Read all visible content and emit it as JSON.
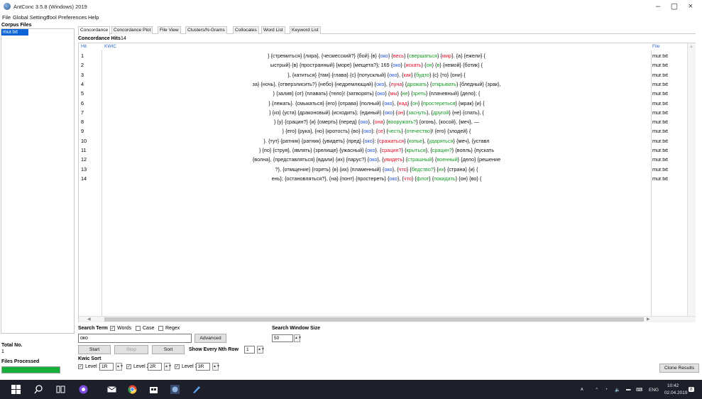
{
  "window": {
    "title": "AntConc 3.5.8 (Windows) 2019",
    "minimize": "–",
    "maximize": "▢",
    "close": "×"
  },
  "menu": [
    "File",
    "Global Settings",
    "Tool Preferences",
    "Help"
  ],
  "left": {
    "corpus_label": "Corpus Files",
    "corpus_file": "mur.txt",
    "total_label": "Total No.",
    "total_value": "1",
    "files_label": "Files Processed",
    "files_progress": 1.0
  },
  "tabs": [
    "Concordance",
    "Concordance Plot",
    "File View",
    "Clusters/N-Grams",
    "Collocates",
    "Word List",
    "Keyword List"
  ],
  "concordance": {
    "hits_label": "Concordance Hits",
    "hits_count": "14",
    "col_hit": "Hit",
    "col_kwic": "KWIC",
    "col_file": "File",
    "rows": [
      {
        "n": "1",
        "file": "mur.txt",
        "parts": [
          [
            "plain",
            "} {стремиться} {лира}, {чесмесский?} {бой} {в} {"
          ],
          [
            "blue",
            "око"
          ],
          [
            "plain",
            "} {"
          ],
          [
            "red",
            "весь"
          ],
          [
            "plain",
            "} {"
          ],
          [
            "green",
            "свершаться"
          ],
          [
            "plain",
            "} {"
          ],
          [
            "red",
            "мир"
          ],
          [
            "plain",
            "}. {а} {ежели} {"
          ]
        ]
      },
      {
        "n": "2",
        "file": "mur.txt",
        "parts": [
          [
            "plain",
            "ыстрый} {в} {пространный} {море} {мещета?}; 165 {"
          ],
          [
            "blue",
            "око"
          ],
          [
            "plain",
            "} {"
          ],
          [
            "red",
            "искать"
          ],
          [
            "plain",
            "} {"
          ],
          [
            "green",
            "он"
          ],
          [
            "plain",
            "} {"
          ],
          [
            "green",
            "в"
          ],
          [
            "plain",
            "} {немой} {ботик} {"
          ]
        ]
      },
      {
        "n": "3",
        "file": "mur.txt",
        "parts": [
          [
            "plain",
            "}, {катиться} {там} {глава} {с} {потусклый} {"
          ],
          [
            "blue",
            "око"
          ],
          [
            "plain",
            "}, {"
          ],
          [
            "red",
            "как"
          ],
          [
            "plain",
            "} {"
          ],
          [
            "green",
            "будто"
          ],
          [
            "plain",
            "} {с} {то} {они} {"
          ]
        ]
      },
      {
        "n": "4",
        "file": "mur.txt",
        "parts": [
          [
            "plain",
            "за} {ночь}, {отверзлисить?} {небо} {недремлющий} {"
          ],
          [
            "blue",
            "око"
          ],
          [
            "plain",
            "}, {"
          ],
          [
            "red",
            "луна"
          ],
          [
            "plain",
            "} {"
          ],
          [
            "green",
            "дрожать"
          ],
          [
            "plain",
            "} {"
          ],
          [
            "green",
            "открывать"
          ],
          [
            "plain",
            "} {бледный} {зрак},"
          ]
        ]
      },
      {
        "n": "5",
        "file": "mur.txt",
        "parts": [
          [
            "plain",
            "} {залив} {от} {плавать} {тело}! {затворять} {"
          ],
          [
            "blue",
            "око"
          ],
          [
            "plain",
            "} {"
          ],
          [
            "red",
            "мы"
          ],
          [
            "plain",
            "} {"
          ],
          [
            "green",
            "не"
          ],
          [
            "plain",
            "} {"
          ],
          [
            "green",
            "зреть"
          ],
          [
            "plain",
            "} {плачевный} {дело}; {"
          ]
        ]
      },
      {
        "n": "6",
        "file": "mur.txt",
        "parts": [
          [
            "plain",
            "} {лежать}. {смыкаться} {его} {отрава} {полный} {"
          ],
          [
            "blue",
            "око"
          ],
          [
            "plain",
            "}, {"
          ],
          [
            "red",
            "над"
          ],
          [
            "plain",
            "} {"
          ],
          [
            "green",
            "он"
          ],
          [
            "plain",
            "} {"
          ],
          [
            "green",
            "простереться"
          ],
          [
            "plain",
            "} {мрак} {и} {"
          ]
        ]
      },
      {
        "n": "7",
        "file": "mur.txt",
        "parts": [
          [
            "plain",
            "} {из} {уста} {драконовый} {исходить}; {единый} {"
          ],
          [
            "blue",
            "око"
          ],
          [
            "plain",
            "} {"
          ],
          [
            "red",
            "он"
          ],
          [
            "plain",
            "} {"
          ],
          [
            "green",
            "заснуть"
          ],
          [
            "plain",
            "}, {"
          ],
          [
            "green",
            "другой"
          ],
          [
            "plain",
            "} {не} {спать}, {"
          ]
        ]
      },
      {
        "n": "8",
        "file": "mur.txt",
        "parts": [
          [
            "plain",
            "} {у} {срацин?} {и} {смерть} {перед} {"
          ],
          [
            "blue",
            "око"
          ],
          [
            "plain",
            "}, {"
          ],
          [
            "red",
            "она"
          ],
          [
            "plain",
            "} {"
          ],
          [
            "green",
            "вооружать?"
          ],
          [
            "plain",
            "} {огонь}, {косой}, {меч}, —"
          ]
        ]
      },
      {
        "n": "9",
        "file": "mur.txt",
        "parts": [
          [
            "plain",
            "} {его} {рука}, {но} {кротость} {во} {"
          ],
          [
            "blue",
            "око"
          ],
          [
            "plain",
            "}: {"
          ],
          [
            "red",
            "се"
          ],
          [
            "plain",
            "} {"
          ],
          [
            "green",
            "честь"
          ],
          [
            "plain",
            "} {"
          ],
          [
            "green",
            "отечество"
          ],
          [
            "plain",
            "}! {его} {злодей} {"
          ]
        ]
      },
      {
        "n": "10",
        "file": "mur.txt",
        "parts": [
          [
            "plain",
            "}. {тут} {ратник} {ратник} {увидеть} {пред} {"
          ],
          [
            "blue",
            "око"
          ],
          [
            "plain",
            "}: {"
          ],
          [
            "red",
            "сражаться"
          ],
          [
            "plain",
            "} {"
          ],
          [
            "green",
            "копье"
          ],
          [
            "plain",
            "}, {"
          ],
          [
            "green",
            "ударяться"
          ],
          [
            "plain",
            "} {меч}, {уставл"
          ]
        ]
      },
      {
        "n": "11",
        "file": "mur.txt",
        "parts": [
          [
            "plain",
            "} {по} {струя}, {являть} {зрелище} {ужасный} {"
          ],
          [
            "blue",
            "око"
          ],
          [
            "plain",
            "}. {"
          ],
          [
            "red",
            "срацин?"
          ],
          [
            "plain",
            "} {"
          ],
          [
            "green",
            "крыться"
          ],
          [
            "plain",
            "}, {"
          ],
          [
            "green",
            "срацин?"
          ],
          [
            "plain",
            "} {вопль} {пускать"
          ]
        ]
      },
      {
        "n": "12",
        "file": "mur.txt",
        "parts": [
          [
            "plain",
            "{волна}, {представляться} {вдали} {их} {парус?} {"
          ],
          [
            "blue",
            "око"
          ],
          [
            "plain",
            "}, {"
          ],
          [
            "red",
            "увидеть"
          ],
          [
            "plain",
            "} {"
          ],
          [
            "green",
            "страшный"
          ],
          [
            "plain",
            "} {"
          ],
          [
            "green",
            "военный"
          ],
          [
            "plain",
            "} {дело} {решение"
          ]
        ]
      },
      {
        "n": "13",
        "file": "mur.txt",
        "parts": [
          [
            "plain",
            "?}, {отмщение} {гореть} {в} {их} {пламенный} {"
          ],
          [
            "blue",
            "око"
          ],
          [
            "plain",
            "}, {"
          ],
          [
            "red",
            "что"
          ],
          [
            "plain",
            "} {"
          ],
          [
            "green",
            "бедство?"
          ],
          [
            "plain",
            "} {"
          ],
          [
            "green",
            "их"
          ],
          [
            "plain",
            "} {страна} {и} {"
          ]
        ]
      },
      {
        "n": "14",
        "file": "mur.txt",
        "parts": [
          [
            "plain",
            "ень}; {остановляться?}, {на} {понт} {простереть} {"
          ],
          [
            "blue",
            "око"
          ],
          [
            "plain",
            "}, {"
          ],
          [
            "red",
            "что"
          ],
          [
            "plain",
            "} {"
          ],
          [
            "green",
            "флот"
          ],
          [
            "plain",
            "} {"
          ],
          [
            "green",
            "покидать"
          ],
          [
            "plain",
            "} {он} {во} {"
          ]
        ]
      }
    ]
  },
  "search": {
    "term_label": "Search Term",
    "words_label": "Words",
    "case_label": "Case",
    "regex_label": "Regex",
    "query": "око",
    "advanced_label": "Advanced",
    "window_label": "Search Window Size",
    "window_value": "50",
    "start_label": "Start",
    "stop_label": "Stop",
    "sort_label": "Sort",
    "nth_label": "Show Every Nth Row",
    "nth_value": "1",
    "kwic_sort_label": "Kwic Sort",
    "level1_label": "Level 1",
    "level1_value": "1R",
    "level2_label": "Level 2",
    "level2_value": "2R",
    "level3_label": "Level 3",
    "level3_value": "3R",
    "clone_label": "Clone Results"
  },
  "taskbar": {
    "lang": "ENG",
    "time": "10:42",
    "date": "02.04.2019",
    "notif_count": "8"
  }
}
